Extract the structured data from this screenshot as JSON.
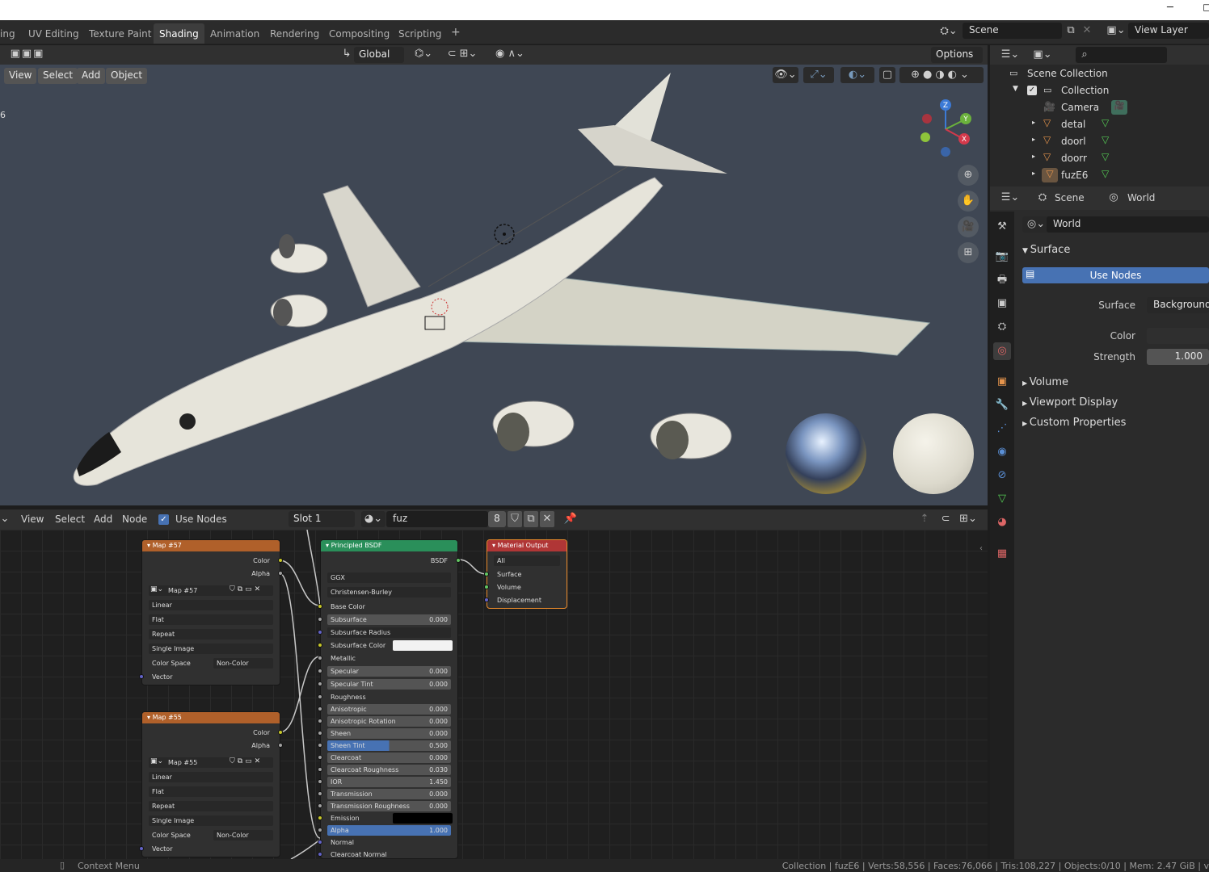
{
  "window": {
    "minimize_glyph": "─",
    "maximize_glyph": "◻"
  },
  "workspace_tabs": [
    "ing",
    "UV Editing",
    "Texture Paint",
    "Shading",
    "Animation",
    "Rendering",
    "Compositing",
    "Scripting",
    "+"
  ],
  "active_tab": "Shading",
  "scene_selector": {
    "scene": "Scene",
    "view_layer": "View Layer"
  },
  "viewport_header": {
    "transform_orientation": "Global",
    "options": "Options"
  },
  "viewport_menu": [
    "View",
    "Select",
    "Add",
    "Object"
  ],
  "viewport_overlay_text": "6",
  "gizmo_axes": {
    "z": "Z",
    "y": "Y",
    "x": "X"
  },
  "outliner": {
    "root": "Scene Collection",
    "collection": "Collection",
    "items": [
      "Camera",
      "detal",
      "doorl",
      "doorr",
      "fuzE6"
    ]
  },
  "properties": {
    "header_scene": "Scene",
    "header_world": "World",
    "world_name": "World",
    "surface_section": "Surface",
    "use_nodes_button": "Use Nodes",
    "surface_label": "Surface",
    "surface_value": "Background",
    "color_label": "Color",
    "strength_label": "Strength",
    "strength_value": "1.000",
    "sections": [
      "Volume",
      "Viewport Display",
      "Custom Properties"
    ]
  },
  "node_editor_header": {
    "menu": [
      "View",
      "Select",
      "Add",
      "Node"
    ],
    "use_nodes": "Use Nodes",
    "slot": "Slot 1",
    "material": "fuz",
    "users": "8"
  },
  "nodes": {
    "map57": {
      "title": "Map #57",
      "out_color": "Color",
      "out_alpha": "Alpha",
      "image": "Map #57",
      "interp": "Linear",
      "proj": "Flat",
      "ext": "Repeat",
      "source": "Single Image",
      "cs_label": "Color Space",
      "cs_value": "Non-Color",
      "in_vector": "Vector"
    },
    "map55": {
      "title": "Map #55",
      "out_color": "Color",
      "out_alpha": "Alpha",
      "image": "Map #55",
      "interp": "Linear",
      "proj": "Flat",
      "ext": "Repeat",
      "source": "Single Image",
      "cs_label": "Color Space",
      "cs_value": "Non-Color",
      "in_vector": "Vector"
    },
    "bsdf": {
      "title": "Principled BSDF",
      "out": "BSDF",
      "dist": "GGX",
      "sss_method": "Christensen-Burley",
      "rows": [
        {
          "label": "Base Color",
          "value": "",
          "kind": "label"
        },
        {
          "label": "Subsurface",
          "value": "0.000",
          "kind": "field"
        },
        {
          "label": "Subsurface Radius",
          "value": "",
          "kind": "drop"
        },
        {
          "label": "Subsurface Color",
          "value": "",
          "kind": "color-white"
        },
        {
          "label": "Metallic",
          "value": "",
          "kind": "label"
        },
        {
          "label": "Specular",
          "value": "0.000",
          "kind": "field"
        },
        {
          "label": "Specular Tint",
          "value": "0.000",
          "kind": "field"
        },
        {
          "label": "Roughness",
          "value": "",
          "kind": "label"
        },
        {
          "label": "Anisotropic",
          "value": "0.000",
          "kind": "field"
        },
        {
          "label": "Anisotropic Rotation",
          "value": "0.000",
          "kind": "field"
        },
        {
          "label": "Sheen",
          "value": "0.000",
          "kind": "field"
        },
        {
          "label": "Sheen Tint",
          "value": "0.500",
          "kind": "field-half"
        },
        {
          "label": "Clearcoat",
          "value": "0.000",
          "kind": "field"
        },
        {
          "label": "Clearcoat Roughness",
          "value": "0.030",
          "kind": "field"
        },
        {
          "label": "IOR",
          "value": "1.450",
          "kind": "field"
        },
        {
          "label": "Transmission",
          "value": "0.000",
          "kind": "field"
        },
        {
          "label": "Transmission Roughness",
          "value": "0.000",
          "kind": "field"
        },
        {
          "label": "Emission",
          "value": "",
          "kind": "color-black"
        },
        {
          "label": "Alpha",
          "value": "1.000",
          "kind": "field-full"
        },
        {
          "label": "Normal",
          "value": "",
          "kind": "label"
        },
        {
          "label": "Clearcoat Normal",
          "value": "",
          "kind": "label"
        }
      ]
    },
    "output": {
      "title": "Material Output",
      "target": "All",
      "surface": "Surface",
      "volume": "Volume",
      "displacement": "Displacement"
    }
  },
  "statusbar": {
    "left": "Context Menu",
    "right": "Collection | fuzE6 | Verts:58,556 | Faces:76,066 | Tris:108,227 | Objects:0/10 | Mem: 2.47 GiB | v"
  },
  "colors": {
    "accent_blue": "#4772b3",
    "node_texture_header": "#b0602a",
    "node_shader_header": "#2a8f5a",
    "node_output_header": "#b03636",
    "socket_yellow": "#c7c729",
    "socket_purple": "#6363c7",
    "socket_green": "#63c763",
    "socket_gray": "#a1a1a1"
  }
}
